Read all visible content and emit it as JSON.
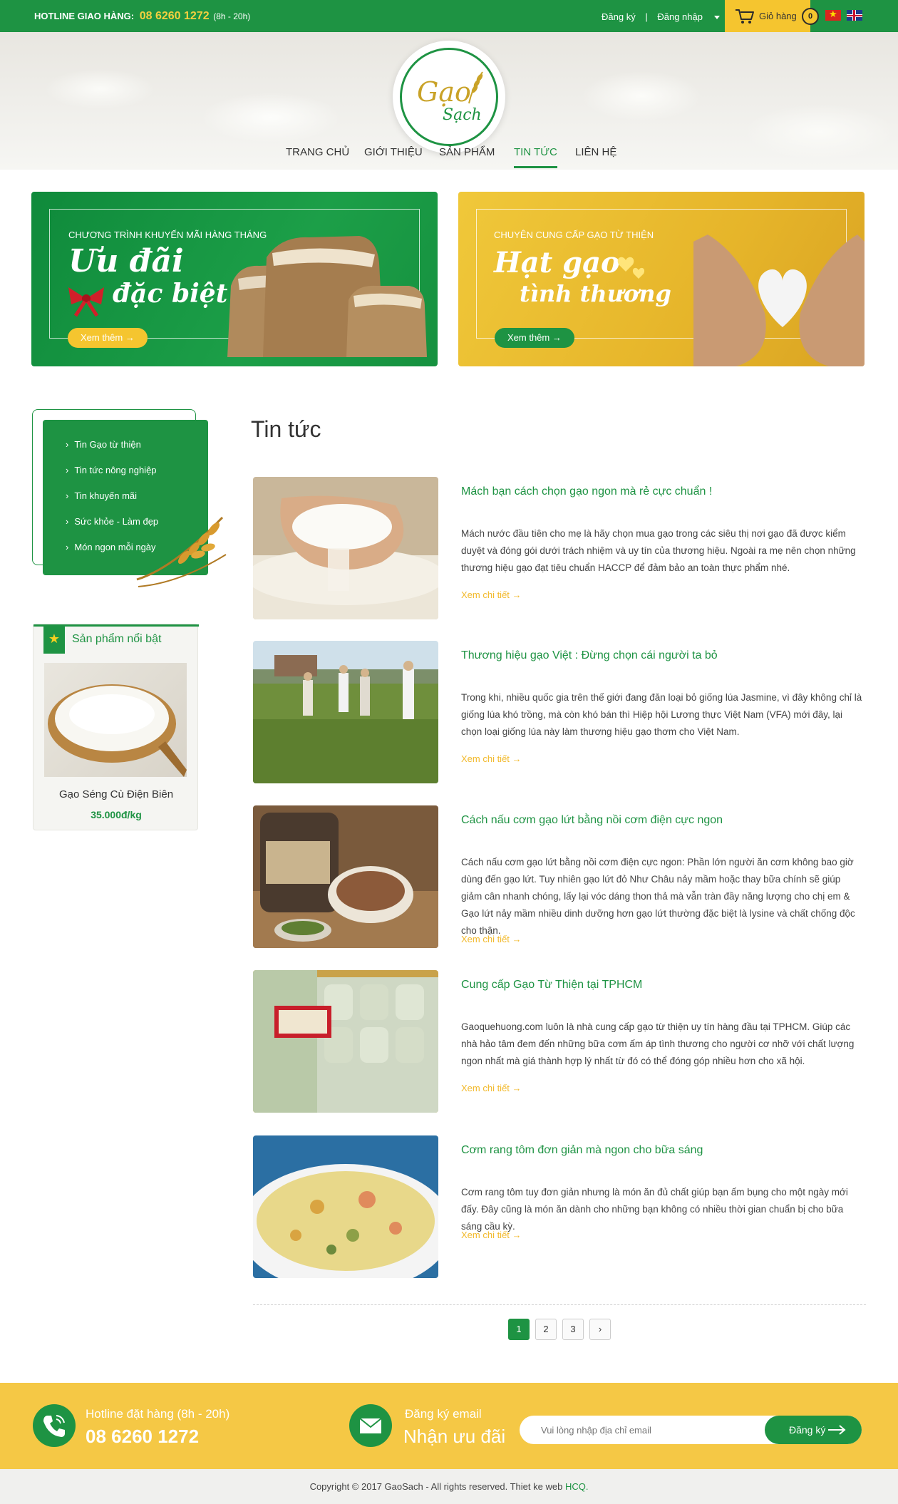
{
  "header": {
    "hotline_label": "HOTLINE GIAO HÀNG:",
    "hotline_number": "08 6260 1272",
    "hotline_hours": "(8h - 20h)",
    "register": "Đăng ký",
    "separator": "|",
    "login": "Đăng nhập",
    "cart_label": "Giỏ hàng",
    "cart_count": "0"
  },
  "logo": {
    "line1": "Gạo",
    "line2": "Sạch"
  },
  "nav": [
    {
      "label": "TRANG CHỦ"
    },
    {
      "label": "GIỚI THIỆU"
    },
    {
      "label": "SẢN PHẨM"
    },
    {
      "label": "TIN TỨC",
      "active": true
    },
    {
      "label": "LIÊN HỆ"
    }
  ],
  "banners": [
    {
      "subtitle": "CHƯƠNG TRÌNH KHUYẾN MÃI HÀNG THÁNG",
      "title1": "Ưu đãi",
      "title2": "đặc biệt",
      "button": "Xem thêm →"
    },
    {
      "subtitle": "CHUYÊN CUNG CẤP GẠO TỪ THIỆN",
      "title1": "Hạt gạo",
      "title2": "tình thương",
      "button": "Xem thêm →"
    }
  ],
  "sidebar": {
    "categories": [
      {
        "label": "Tin Gạo từ thiện"
      },
      {
        "label": "Tin tức nông nghiệp"
      },
      {
        "label": "Tin khuyến mãi"
      },
      {
        "label": "Sức khỏe - Làm đẹp"
      },
      {
        "label": "Món ngon mỗi ngày"
      }
    ],
    "featured_title": "Sản phẩm nổi bật",
    "featured_product": {
      "name": "Gạo Séng Cù Điện Biên",
      "price": "35.000đ/kg"
    }
  },
  "main": {
    "title": "Tin tức",
    "read_more": "Xem chi tiết →",
    "posts": [
      {
        "title": "Mách bạn cách chọn gạo ngon mà rẻ cực chuẩn !",
        "excerpt": "Mách nước đầu tiên cho mẹ là hãy chọn mua gạo trong các siêu thị nơi gạo đã được kiểm duyệt và đóng gói dưới trách nhiệm và uy tín của thương hiệu. Ngoài ra mẹ nên chọn những thương hiệu gạo đạt tiêu chuẩn HACCP để đảm bảo an toàn thực phẩm nhé."
      },
      {
        "title": "Thương hiệu gạo Việt : Đừng chọn cái người ta bỏ",
        "excerpt": "Trong khi, nhiều quốc gia trên thế giới đang đăn loại bỏ giống lúa Jasmine, vì đây không chỉ là giống lúa khó trồng, mà còn khó bán thì Hiệp hội Lương thực Việt Nam (VFA) mới đây, lại chọn loại giống lúa này làm thương hiệu gạo thơm cho Việt Nam."
      },
      {
        "title": "Cách nấu cơm gạo lứt bằng nồi cơm điện cực ngon",
        "excerpt": "Cách nấu cơm gạo lứt bằng nồi cơm điện cực ngon: Phần lớn người ăn cơm không bao giờ dùng đến gạo lứt. Tuy nhiên gạo lứt đỏ Như Châu nảy mầm hoặc thay bữa chính sẽ giúp giảm cân nhanh chóng, lấy lại vóc dáng thon thả mà vẫn tràn đầy năng lượng cho chị em & Gạo lứt nảy mầm nhiều dinh dưỡng hơn gạo lứt thường đặc biệt là lysine và chất chống độc cho thận."
      },
      {
        "title": "Cung cấp Gạo Từ Thiện tại TPHCM",
        "excerpt": "Gaoquehuong.com luôn là nhà cung cấp gạo từ thiện uy tín hàng đầu tại TPHCM. Giúp các nhà hảo tâm đem đến những bữa cơm ấm áp tình thương cho người cơ nhỡ với chất lượng ngon nhất mà giá thành hợp lý nhất từ đó có thể đóng góp nhiều hơn cho xã hội."
      },
      {
        "title": "Cơm rang tôm đơn giản mà ngon cho bữa sáng",
        "excerpt": "Cơm rang tôm tuy đơn giản nhưng là món ăn đủ chất giúp bạn ấm bụng cho một ngày mới đấy. Đây cũng là món ăn dành cho những bạn không có nhiều thời gian chuẩn bị cho bữa sáng cầu kỳ."
      }
    ],
    "pagination": [
      "1",
      "2",
      "3",
      "›"
    ]
  },
  "footer": {
    "hotline_label": "Hotline đặt hàng (8h - 20h)",
    "hotline_number": "08 6260 1272",
    "email_label": "Đăng ký email",
    "email_title": "Nhận ưu đãi",
    "email_placeholder": "Vui lòng nhập địa chỉ email",
    "email_button": "Đăng ký",
    "copyright_text": "Copyright © 2017 GaoSach - All rights reserved. Thiet ke web",
    "copyright_link": "HCQ."
  },
  "colors": {
    "green": "#1e9343",
    "yellow": "#f5c52f",
    "gold_text": "#f2b92b"
  },
  "icons": [
    "cart-icon",
    "phone-icon",
    "mail-icon",
    "star-icon",
    "arrow-right-icon",
    "chevron-right-icon"
  ]
}
